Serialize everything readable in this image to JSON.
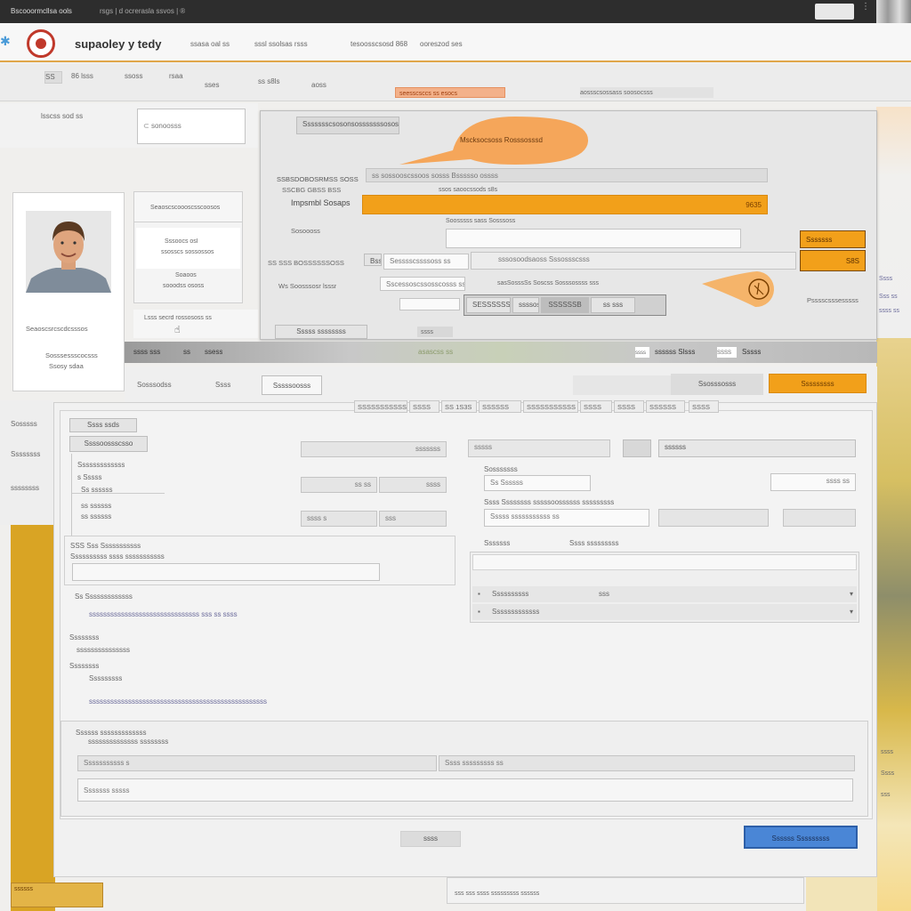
{
  "titlebar": {
    "title": "Bscooormcllsa ools",
    "subtitle": "rsgs | d ocrerasla ssvos | ®"
  },
  "appbar": {
    "brand": "supaoley y tedy",
    "links": [
      "ssasa oal ss",
      "sssl ssolsas rsss",
      "tesoosscsosd 868",
      "ooreszod ses"
    ]
  },
  "menustrip": {
    "items": [
      "SS",
      "86 lsss",
      "ssoss",
      "rsaa",
      "sses",
      "ss s8ls",
      "aoss"
    ],
    "highlight": "seesscsccs ss esocs",
    "right": "aossscsossass soosocsss"
  },
  "toolbar": {
    "label": "lsscss sod ss",
    "search_value": "sonoosss"
  },
  "profile": {
    "name": "Seaoscsrcscdcsssos",
    "line1": "Sosssessscocsss",
    "line2": "Ssosy sdaa"
  },
  "info_card": {
    "header": "Seaoscscoooscsscoosos",
    "line1": "Sssoocs osl",
    "line2": "ssosscs sossossos",
    "line3": "Soaoos",
    "line4": "sooodss ososs"
  },
  "hint": {
    "text": "Lsss secrd  rossososs ss",
    "cursor": "☝"
  },
  "dialog": {
    "title_button": "Ssssssscsosonsosssssssososs",
    "callout": "Mscksocsoss Rosssosssd",
    "rows": [
      {
        "label": "SSBSDOBOSRMSS SOSS",
        "value": "ss sossooscssoos sosss Bssssso ossss"
      },
      {
        "label": "SSCBG GBSS BSS",
        "value": "ssos saoocssods s8s"
      },
      {
        "label": "Impsmbl  Sosaps",
        "value": "9635"
      },
      {
        "label": "Sosoooss",
        "value": "Soosssss sass  Sosssoss"
      },
      {
        "label": "SS SSS BOSSSSSSOSS",
        "value": "Sesssscssssoss ss"
      }
    ],
    "row5_combo": "Bsss",
    "row5_extra": "sssosoodsaoss Sssossscsss",
    "row6_label": "Ws  Soosssosr lsssr",
    "row6_combo": "Sscessoscssosscosss ssd",
    "row6_value": "sasSosssSs Soscss  Sosssossss sss",
    "seg": [
      "SESSSSSSS",
      "ssssos",
      "SSSSSSB",
      "ss sss"
    ],
    "side_orange_1": "Sssssss",
    "side_orange_2": "S8S",
    "side_note": "Psssscsssesssss",
    "footer_btn": "Sssss ssssssss",
    "footer_tag": "ssss"
  },
  "breadcrumb": {
    "items": [
      "ssss sss",
      "ss",
      "ssess"
    ],
    "status_center": "asascss ss",
    "right_items": [
      "ssss",
      "ssssss Slsss",
      "SSSS",
      "Sssss"
    ]
  },
  "panel_toolbar": {
    "items": [
      "Sosssodss",
      "Ssss",
      "Sssssoosss"
    ],
    "right_btn": "Ssosssosss",
    "accent_btn": "Sssssssss"
  },
  "tabs": [
    "SSSSSSSSSSS",
    "SSSS",
    "SS 1S3S",
    "SSSSSS",
    "SSSSSSSSSSS",
    "SSSS",
    "SSSS",
    "SSSSSS",
    "SSSS"
  ],
  "form": {
    "group_title": "Ssss ssds",
    "group2_title": "Ssssoossscsso",
    "tree": [
      "Sssssssssssss",
      "s Sssss",
      "Ss ssssss",
      "ss  ssssss",
      "ss  ssssss"
    ],
    "mid_inputs": [
      "sssssss",
      "ss ss",
      "ssss",
      "ssss s",
      "sss",
      "ss sssss"
    ],
    "right_inputs": [
      "sssss",
      "ssssss",
      "ssss ss"
    ],
    "right_labels": [
      "Sosssssss",
      "Ss  Ssssss",
      "Ssss Ssssssss  sssssoossssss sssssssss",
      "Sssss sssssssssss ss",
      "Sssssss",
      "Ssss sssssssss"
    ],
    "right_list": [
      "Ssssssssss",
      "Sssssssssssss"
    ],
    "right_list_vals": [
      "sss"
    ],
    "section_a": "SSS Sss Sssssssssss",
    "section_a_sub": "Ssssssssss ssss sssssssssss",
    "section_b": "Ss Sssssssssssss",
    "section_b_line": "sssssssssssssssssssssssssssssss sss ss ssss",
    "section_c": "Ssssssss",
    "section_c_line": "sssssssssssssss",
    "section_d": "Ssssssss",
    "section_d_line1": "Sssssssss",
    "section_d_line2": "ssssssssssssssssssssssssssssssssssssssssssssssssss",
    "section_e": "Ssssss sssssssssssss",
    "section_e_line": "ssssssssssssss ssssssss",
    "bottom_inputs": [
      "Sssssssssss s",
      "Ssss sssssssss ss",
      "Sssssss sssss"
    ],
    "cancel_btn": "ssss",
    "primary_btn": "Ssssss Sssssssss"
  },
  "left_strip": [
    "Sosssss",
    "Ssssssss",
    "ssssssss"
  ],
  "right_strip": [
    "Ssss",
    "Sss ss",
    "ssss ss",
    "ssss",
    "Ssss",
    "sss"
  ],
  "bottom": {
    "left_text": "ssssss",
    "center_text": "sss sss  ssss sssssssss ssssss"
  },
  "colors": {
    "accent": "#f2a01a",
    "orange_callout": "#f5a65a",
    "blue_btn": "#3a78d0",
    "gold": "#d9a424",
    "topbar": "#2b2b2b"
  }
}
